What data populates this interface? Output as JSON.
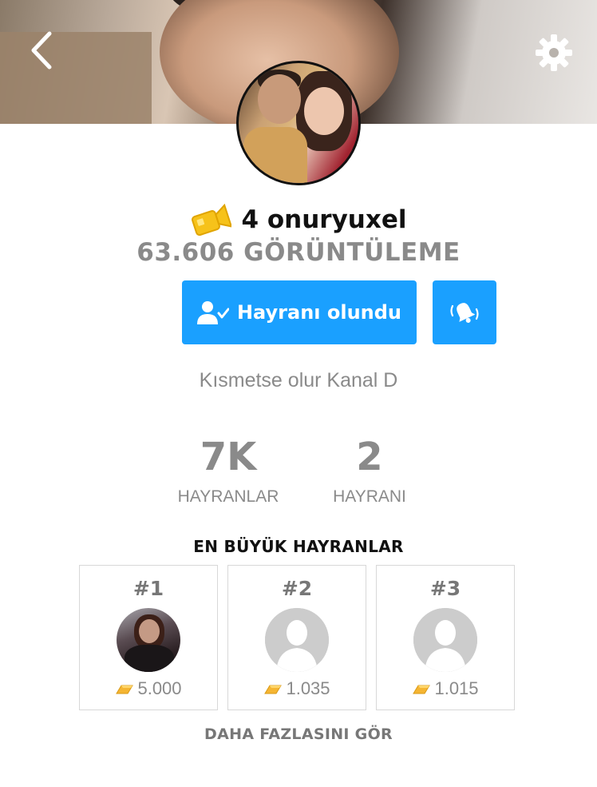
{
  "profile": {
    "level": "4",
    "username": "onuryuxel",
    "views": "63.606 GÖRÜNTÜLEME",
    "follow_button": "Hayranı olundu",
    "bio": "Kısmetse olur Kanal D"
  },
  "stats": [
    {
      "value": "7K",
      "label": "HAYRANLAR"
    },
    {
      "value": "2",
      "label": "HAYRANI"
    }
  ],
  "top_fans": {
    "title": "EN BÜYÜK HAYRANLAR",
    "fans": [
      {
        "rank": "#1",
        "gold": "5.000"
      },
      {
        "rank": "#2",
        "gold": "1.035"
      },
      {
        "rank": "#3",
        "gold": "1.015"
      }
    ],
    "more_label": "DAHA FAZLASINI GÖR"
  },
  "colors": {
    "accent": "#1aa0ff",
    "gold": "#f5b532",
    "muted_text": "#8a8a8a"
  },
  "icons": [
    "back-arrow-icon",
    "gear-icon",
    "video-camera-icon",
    "user-check-icon",
    "bell-ringing-icon",
    "gold-bar-icon",
    "default-avatar-icon"
  ]
}
